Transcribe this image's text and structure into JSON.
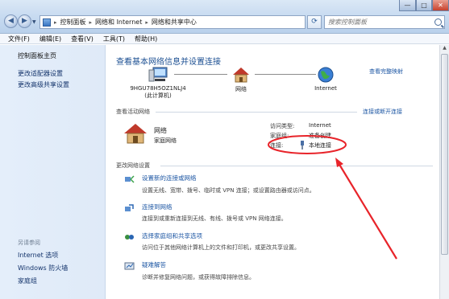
{
  "window": {
    "minimize_glyph": "—",
    "maximize_glyph": "□",
    "close_glyph": "✕"
  },
  "address": {
    "crumbs": [
      "控制面板",
      "网络和 Internet",
      "网络和共享中心"
    ],
    "separator": "▸"
  },
  "search": {
    "placeholder": "搜索控制面板"
  },
  "menu": [
    "文件(F)",
    "编辑(E)",
    "查看(V)",
    "工具(T)",
    "帮助(H)"
  ],
  "sidebar": {
    "top_links": [
      "控制面板主页",
      "更改适配器设置",
      "更改高级共享设置"
    ],
    "see_also_label": "另请参阅",
    "bottom_links": [
      "Internet 选项",
      "Windows 防火墙",
      "家庭组"
    ]
  },
  "main": {
    "title": "查看基本网络信息并设置连接",
    "full_map_link": "查看完整映射",
    "network_map": {
      "computer_name": "9HGU78H5OZ1NLJ4",
      "computer_subtitle": "(此计算机)",
      "network_label": "网络",
      "internet_label": "Internet"
    },
    "active_networks": {
      "section_title": "查看活动网络",
      "connect_link": "连接或断开连接",
      "network_name": "网络",
      "network_type": "家庭网络",
      "access_type_key": "访问类型:",
      "access_type_val": "Internet",
      "homegroup_key": "家庭组:",
      "homegroup_val": "准备创建",
      "connection_key": "连接:",
      "connection_val": "本地连接"
    },
    "settings": {
      "section_title": "更改网络设置",
      "tasks": [
        {
          "title": "设置新的连接或网络",
          "desc": "设置无线、宽带、拨号、临时或 VPN 连接；或设置路由器或访问点。"
        },
        {
          "title": "连接到网络",
          "desc": "连接到或重新连接到无线、有线、拨号或 VPN 网络连接。"
        },
        {
          "title": "选择家庭组和共享选项",
          "desc": "访问位于其他网络计算机上的文件和打印机，或更改共享设置。"
        },
        {
          "title": "疑难解答",
          "desc": "诊断并修复网络问题，或获得故障排除信息。"
        }
      ]
    }
  },
  "colors": {
    "link": "#1c56a3",
    "title": "#1b4f92",
    "annotation": "#e8242a",
    "sidebar_bg": "#e4eefa"
  }
}
